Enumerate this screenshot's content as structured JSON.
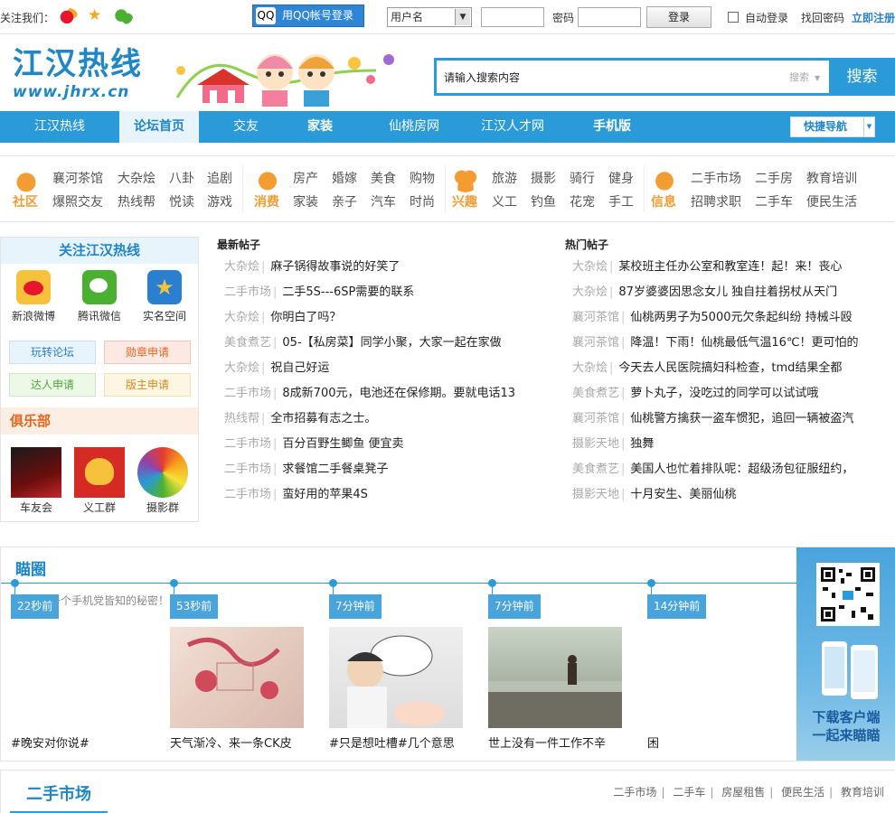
{
  "topbar": {
    "follow_label": "关注我们：",
    "qq_login": "用QQ帐号登录",
    "qq_icon_glyph": "QQ",
    "user_select": "用户名",
    "password_label": "密码",
    "login_button": "登录",
    "auto_login": "自动登录",
    "find_password": "找回密码",
    "register": "立即注册"
  },
  "header": {
    "logo_title": "江汉热线",
    "logo_url": "www.jhrx.cn",
    "search_placeholder": "请输入搜索内容",
    "search_type": "搜索",
    "search_button": "搜索"
  },
  "nav": {
    "items": [
      {
        "label": "江汉热线"
      },
      {
        "label": "论坛首页"
      },
      {
        "label": "交友"
      },
      {
        "label": "家装"
      },
      {
        "label": "仙桃房网"
      },
      {
        "label": "江汉人才网"
      },
      {
        "label": "手机版"
      }
    ],
    "quick_nav": "快捷导航"
  },
  "categories": {
    "shequ": {
      "name": "社区",
      "links": [
        "襄河茶馆",
        "大杂烩",
        "八卦",
        "追剧",
        "爆照交友",
        "热线帮",
        "悦读",
        "游戏"
      ]
    },
    "xiaofei": {
      "name": "消费",
      "links": [
        "房产",
        "婚嫁",
        "美食",
        "购物",
        "家装",
        "亲子",
        "汽车",
        "时尚"
      ]
    },
    "xingqu": {
      "name": "兴趣",
      "links": [
        "旅游",
        "摄影",
        "骑行",
        "健身",
        "义工",
        "钓鱼",
        "花宠",
        "手工"
      ]
    },
    "xinxi": {
      "name": "信息",
      "links": [
        "二手市场",
        "二手房",
        "教育培训",
        "招聘求职",
        "二手车",
        "便民生活"
      ]
    }
  },
  "sidebar": {
    "follow_title": "关注江汉热线",
    "services": [
      "新浪微博",
      "腾讯微信",
      "实名空间"
    ],
    "tags": [
      "玩转论坛",
      "勋章申请",
      "达人申请",
      "版主申请"
    ],
    "club_title": "俱乐部",
    "clubs": [
      "车友会",
      "义工群",
      "摄影群"
    ]
  },
  "latest": {
    "title": "最新帖子",
    "posts": [
      {
        "forum": "大杂烩",
        "title": "麻子锅得故事说的好笑了"
      },
      {
        "forum": "二手市场",
        "title": "二手5S---6SP需要的联系"
      },
      {
        "forum": "大杂烩",
        "title": "你明白了吗？"
      },
      {
        "forum": "美食煮艺",
        "title": "05-【私房菜】同学小聚，大家一起在家做"
      },
      {
        "forum": "大杂烩",
        "title": "祝自己好运"
      },
      {
        "forum": "二手市场",
        "title": "8成新700元，电池还在保修期。要就电话13"
      },
      {
        "forum": "热线帮",
        "title": "全市招募有志之士。"
      },
      {
        "forum": "二手市场",
        "title": "百分百野生鲫鱼 便宜卖"
      },
      {
        "forum": "二手市场",
        "title": "求餐馆二手餐桌凳子"
      },
      {
        "forum": "二手市场",
        "title": "蛮好用的苹果4S"
      }
    ]
  },
  "hot": {
    "title": "热门帖子",
    "posts": [
      {
        "forum": "大杂烩",
        "title": "某校班主任办公室和教室连！起！来！丧心"
      },
      {
        "forum": "大杂烩",
        "title": "87岁婆婆因思念女儿 独自拄着拐杖从天门"
      },
      {
        "forum": "襄河茶馆",
        "title": "仙桃两男子为5000元欠条起纠纷 持械斗殴"
      },
      {
        "forum": "襄河茶馆",
        "title": "降温！下雨！仙桃最低气温16℃！更可怕的"
      },
      {
        "forum": "大杂烩",
        "title": "今天去人民医院搞妇科检查，tmd结果全都"
      },
      {
        "forum": "美食煮艺",
        "title": "萝卜丸子，没吃过的同学可以试试哦"
      },
      {
        "forum": "襄河茶馆",
        "title": "仙桃警方擒获一盗车惯犯，追回一辆被盗汽"
      },
      {
        "forum": "摄影天地",
        "title": "独舞"
      },
      {
        "forum": "美食煮艺",
        "title": "美国人也忙着排队呢：超级汤包征服纽约，"
      },
      {
        "forum": "摄影天地",
        "title": "十月安生、美丽仙桃"
      }
    ]
  },
  "miaoquan": {
    "title": "瞄圈",
    "faded_text": "这是一个手机党皆知的秘密！",
    "items": [
      {
        "time": "22秒前",
        "caption": "#晚安对你说#"
      },
      {
        "time": "53秒前",
        "caption": "天气渐冷、来一条CK皮"
      },
      {
        "time": "7分钟前",
        "caption": "#只是想吐槽#几个意思"
      },
      {
        "time": "7分钟前",
        "caption": "世上没有一件工作不辛"
      },
      {
        "time": "14分钟前",
        "caption": "困"
      }
    ],
    "app_text_1": "下载客户端",
    "app_text_2": "一起来瞄瞄"
  },
  "ershou": {
    "title": "二手市场",
    "links": [
      "二手市场",
      "二手车",
      "房屋租售",
      "便民生活",
      "教育培训"
    ]
  },
  "colors": {
    "brand_blue": "#2a9ad8",
    "orange": "#e8641b"
  }
}
